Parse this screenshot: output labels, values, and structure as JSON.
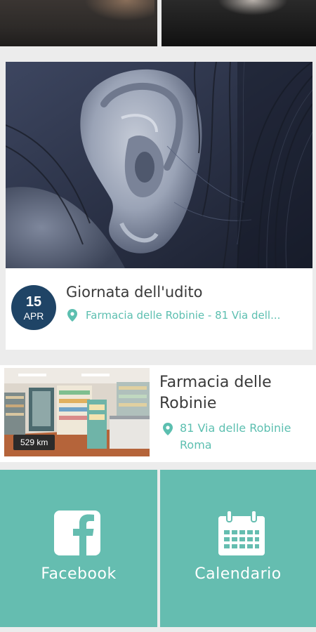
{
  "event": {
    "date_day": "15",
    "date_month": "APR",
    "title": "Giornata dell'udito",
    "location": "Farmacia delle Robinie - 81 Via dell..."
  },
  "pharmacy": {
    "name": "Farmacia delle Robinie",
    "address_line1": "81 Via delle Robinie",
    "address_line2": "Roma",
    "distance": "529 km"
  },
  "tiles": {
    "facebook_label": "Facebook",
    "calendar_label": "Calendario"
  },
  "colors": {
    "accent_teal": "#65bdb0",
    "link_teal": "#5cbfb0",
    "date_badge_navy": "#1f4466"
  },
  "icons": {
    "location": "map-pin-icon",
    "facebook": "facebook-icon",
    "calendar": "calendar-icon"
  }
}
